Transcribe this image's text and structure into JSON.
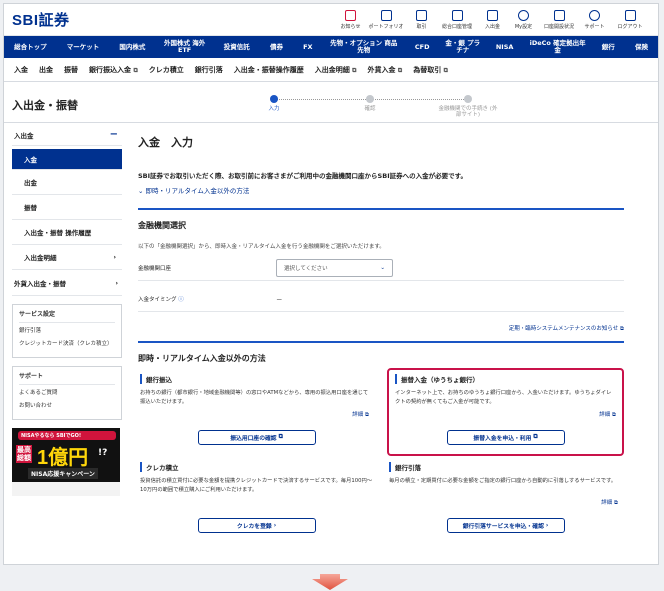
{
  "header": {
    "logo": "SBI証券",
    "icons": [
      {
        "label": "お知らせ",
        "icon": "bell-icon"
      },
      {
        "label": "ポートフォリオ",
        "icon": "portfolio-icon"
      },
      {
        "label": "取引",
        "icon": "trade-icon"
      },
      {
        "label": "総合口座管理",
        "icon": "account-icon"
      },
      {
        "label": "入出金",
        "icon": "deposit-icon"
      },
      {
        "label": "My設定",
        "icon": "user-settings-icon"
      },
      {
        "label": "口座開設状況",
        "icon": "document-icon"
      },
      {
        "label": "サポート",
        "icon": "support-icon"
      },
      {
        "label": "ログアウト",
        "icon": "logout-icon"
      }
    ]
  },
  "nav": [
    "総合トップ",
    "マーケット",
    "国内株式",
    "外国株式 海外ETF",
    "投資信託",
    "債券",
    "FX",
    "先物・オプション 商品先物",
    "CFD",
    "金・銀 プラチナ",
    "NISA",
    "iDeCo 確定拠出年金",
    "銀行",
    "保険"
  ],
  "subnav": [
    "入金",
    "出金",
    "振替",
    "銀行振込入金",
    "クレカ積立",
    "銀行引落",
    "入出金・振替操作履歴",
    "入出金明細",
    "外貨入金",
    "為替取引"
  ],
  "page_title": "入出金・振替",
  "steps": [
    "入力",
    "確認",
    "金融機関での手続き (外部サイト)"
  ],
  "sidebar": {
    "group": "入出金",
    "group_toggle": "−",
    "items": [
      "入金",
      "出金",
      "振替",
      "入出金・振替 操作履歴",
      "入出金明細"
    ],
    "group2": "外貨入出金・振替",
    "service": {
      "title": "サービス設定",
      "items": [
        "銀行引落",
        "クレジットカード決済（クレカ積立）"
      ]
    },
    "support": {
      "title": "サポート",
      "items": [
        "よくあるご質問",
        "お問い合わせ"
      ]
    },
    "banner": {
      "top": "NISAやるなら SBIでGO!",
      "left": "最高総額",
      "amount": "1億円",
      "q": "!?",
      "bottom": "NISA応援キャンペーン"
    }
  },
  "main": {
    "title": "入金　入力",
    "intro": "SBI証券でお取引いただく際、お取引前にお客さまがご利用中の金融機関口座からSBI証券への入金が必要です。",
    "link": "即時・リアルタイム入金以外の方法",
    "sec1": "金融機関選択",
    "note": "以下の「金融機関選択」から、即時入金・リアルタイム入金を行う金融機関をご選択いただけます。",
    "field1_label": "金融機関口座",
    "select_placeholder": "選択してください",
    "field2_label": "入金タイミング",
    "field2_value": "－",
    "maint": "定期・臨時システムメンテナンスのお知らせ",
    "sec2": "即時・リアルタイム入金以外の方法",
    "detail": "詳細",
    "cards": [
      {
        "title": "銀行振込",
        "desc": "お持ちの銀行（都市銀行・地域金融機関等）の窓口やATMなどから、専用の振込用口座を通じて振込いただけます。",
        "btn": "振込用口座の確認"
      },
      {
        "title": "振替入金（ゆうちょ銀行）",
        "desc": "インターネット上で、お持ちのゆうちょ銀行口座から、入金いただけます。ゆうちょダイレクトの契約が無くてもご入金が可能です。",
        "btn": "振替入金を申込・利用"
      },
      {
        "title": "クレカ積立",
        "desc": "投資信託の積立買付に必要な金額を提携クレジットカードで決済するサービスです。毎月100円～10万円の範囲で積立購入にご利用いただけます。",
        "btn": "クレカを登録"
      },
      {
        "title": "銀行引落",
        "desc": "毎月の積立・定期買付に必要な金額をご指定の銀行口座から自動的に引落しするサービスです。",
        "btn": "銀行引落サービスを申込・確認"
      }
    ]
  }
}
